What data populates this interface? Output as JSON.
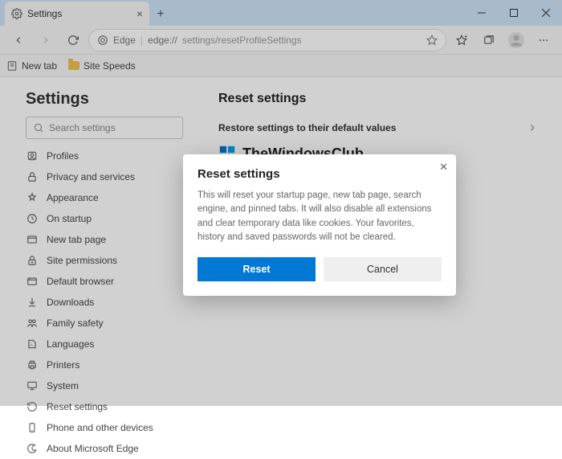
{
  "window": {
    "tab_title": "Settings",
    "minimize_tip": "Minimize",
    "maximize_tip": "Maximize",
    "close_tip": "Close"
  },
  "toolbar": {
    "app_label": "Edge",
    "url_scheme": "edge://",
    "url_path": "settings/resetProfileSettings"
  },
  "bookmarks": {
    "items": [
      {
        "label": "New tab"
      },
      {
        "label": "Site Speeds"
      }
    ]
  },
  "sidebar": {
    "title": "Settings",
    "search_placeholder": "Search settings",
    "items": [
      {
        "label": "Profiles"
      },
      {
        "label": "Privacy and services"
      },
      {
        "label": "Appearance"
      },
      {
        "label": "On startup"
      },
      {
        "label": "New tab page"
      },
      {
        "label": "Site permissions"
      },
      {
        "label": "Default browser"
      },
      {
        "label": "Downloads"
      },
      {
        "label": "Family safety"
      },
      {
        "label": "Languages"
      },
      {
        "label": "Printers"
      },
      {
        "label": "System"
      },
      {
        "label": "Reset settings"
      },
      {
        "label": "Phone and other devices"
      },
      {
        "label": "About Microsoft Edge"
      }
    ]
  },
  "main": {
    "heading": "Reset settings",
    "row_label": "Restore settings to their default values",
    "brand": "TheWindowsClub"
  },
  "modal": {
    "title": "Reset settings",
    "body": "This will reset your startup page, new tab page, search engine, and pinned tabs. It will also disable all extensions and clear temporary data like cookies. Your favorites, history and saved passwords will not be cleared.",
    "reset": "Reset",
    "cancel": "Cancel"
  }
}
